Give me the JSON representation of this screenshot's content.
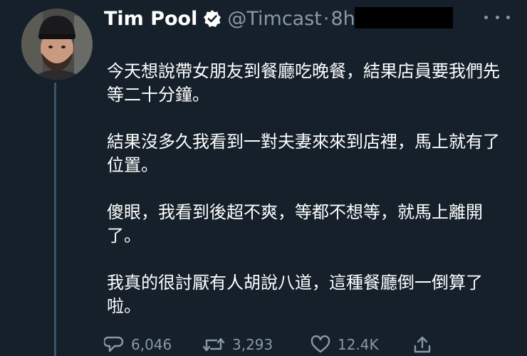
{
  "tweet": {
    "author_name": "Tim Pool",
    "handle": "@Timcast",
    "separator": "·",
    "time": "8h",
    "paragraphs": [
      "今天想說帶女朋友到餐廳吃晚餐，結果店員要我們先等二十分鐘。",
      "結果沒多久我看到一對夫妻來來到店裡，馬上就有了位置。",
      "傻眼，我看到後超不爽，等都不想等，就馬上離開了。",
      "我真的很討厭有人胡說八道，這種餐廳倒一倒算了啦。"
    ],
    "stats": {
      "replies": "6,046",
      "retweets": "3,293",
      "likes": "12.4K"
    }
  },
  "colors": {
    "background": "#15202b",
    "text": "#ffffff",
    "muted": "#8899a6",
    "thread_line": "#3d5466",
    "redaction": "#000000"
  },
  "icons": {
    "verified": "verified-badge-icon",
    "more": "more-dots-icon",
    "reply": "reply-icon",
    "retweet": "retweet-icon",
    "like": "heart-icon",
    "share": "share-icon"
  }
}
